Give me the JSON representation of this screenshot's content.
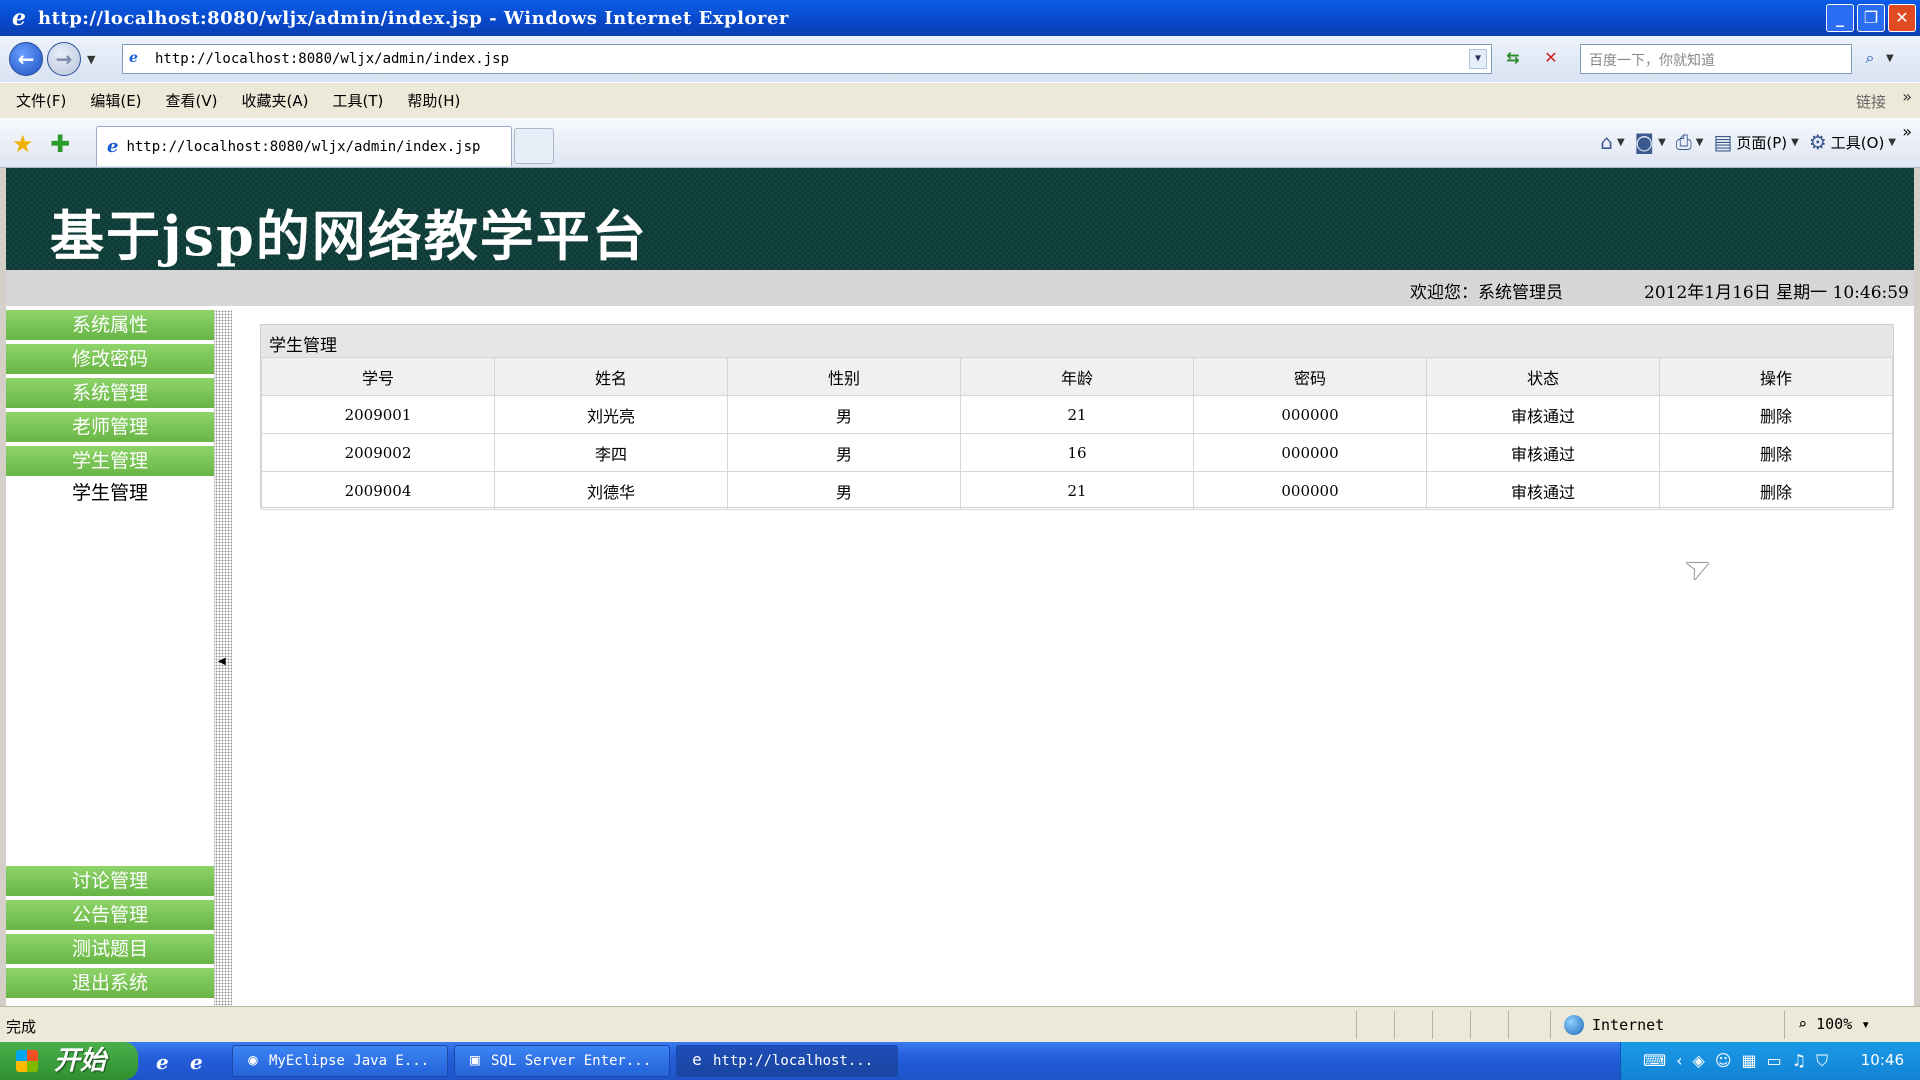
{
  "window": {
    "title": "http://localhost:8080/wljx/admin/index.jsp - Windows Internet Explorer"
  },
  "addressbar": {
    "url": "http://localhost:8080/wljx/admin/index.jsp",
    "search_placeholder": "百度一下，你就知道"
  },
  "menubar": {
    "items": [
      "文件(F)",
      "编辑(E)",
      "查看(V)",
      "收藏夹(A)",
      "工具(T)",
      "帮助(H)"
    ],
    "links_label": "链接"
  },
  "tabbar": {
    "tab_title": "http://localhost:8080/wljx/admin/index.jsp",
    "page_label": "页面(P)",
    "tools_label": "工具(O)"
  },
  "page": {
    "banner_title": "基于jsp的网络教学平台",
    "welcome": "欢迎您：系统管理员",
    "datetime": "2012年1月16日 星期一 10:46:59",
    "sidebar": {
      "top_items": [
        "系统属性",
        "修改密码",
        "系统管理",
        "老师管理",
        "学生管理"
      ],
      "sub_item": "学生管理",
      "bottom_items": [
        "讨论管理",
        "公告管理",
        "测试题目",
        "退出系统"
      ]
    },
    "panel": {
      "title": "学生管理",
      "columns": [
        "学号",
        "姓名",
        "性别",
        "年龄",
        "密码",
        "状态",
        "操作"
      ],
      "rows": [
        [
          "2009001",
          "刘光亮",
          "男",
          "21",
          "000000",
          "审核通过",
          "删除"
        ],
        [
          "2009002",
          "李四",
          "男",
          "16",
          "000000",
          "审核通过",
          "删除"
        ],
        [
          "2009004",
          "刘德华",
          "男",
          "21",
          "000000",
          "审核通过",
          "删除"
        ]
      ]
    }
  },
  "statusbar": {
    "status": "完成",
    "zone": "Internet",
    "zoom": "100%"
  },
  "taskbar": {
    "start_label": "开始",
    "buttons": [
      "MyEclipse Java E...",
      "SQL Server Enter...",
      "http://localhost..."
    ],
    "clock": "10:46"
  }
}
